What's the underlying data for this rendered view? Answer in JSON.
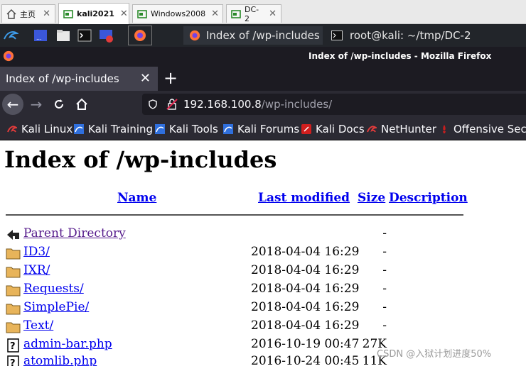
{
  "vm_tabs": [
    {
      "label": "主页"
    },
    {
      "label": "kali2021"
    },
    {
      "label": "Windows2008"
    },
    {
      "label": "DC-2"
    }
  ],
  "taskbar": {
    "windows": [
      {
        "label": "Index of /wp-includes - ..."
      },
      {
        "label": "root@kali: ~/tmp/DC-2"
      }
    ]
  },
  "firefox": {
    "window_title": "Index of /wp-includes - Mozilla Firefox",
    "tab_title": "Index of /wp-includes",
    "new_tab": "+",
    "url_host": "192.168.100.8",
    "url_path": "/wp-includes/"
  },
  "bookmarks": [
    {
      "label": "Kali Linux",
      "color": "#e23b3b"
    },
    {
      "label": "Kali Training",
      "color": "#2f6fdd"
    },
    {
      "label": "Kali Tools",
      "color": "#2f6fdd"
    },
    {
      "label": "Kali Forums",
      "color": "#2f6fdd"
    },
    {
      "label": "Kali Docs",
      "color": "#d01e1e"
    },
    {
      "label": "NetHunter",
      "color": "#e23b3b"
    },
    {
      "label": "Offensive Security",
      "color": "#c81e1e"
    }
  ],
  "listing": {
    "heading": "Index of /wp-includes",
    "columns": {
      "name": "Name",
      "last_modified": "Last modified",
      "size": "Size",
      "description": "Description"
    },
    "rows": [
      {
        "name": "Parent Directory",
        "date": "",
        "size": "-",
        "icon": "back-icon"
      },
      {
        "name": "ID3/",
        "date": "2018-04-04 16:29",
        "size": "-",
        "icon": "folder-icon"
      },
      {
        "name": "IXR/",
        "date": "2018-04-04 16:29",
        "size": "-",
        "icon": "folder-icon"
      },
      {
        "name": "Requests/",
        "date": "2018-04-04 16:29",
        "size": "-",
        "icon": "folder-icon"
      },
      {
        "name": "SimplePie/",
        "date": "2018-04-04 16:29",
        "size": "-",
        "icon": "folder-icon"
      },
      {
        "name": "Text/",
        "date": "2018-04-04 16:29",
        "size": "-",
        "icon": "folder-icon"
      },
      {
        "name": "admin-bar.php",
        "date": "2016-10-19 00:47",
        "size": "27K",
        "icon": "unknown-file-icon"
      },
      {
        "name": "atomlib.php",
        "date": "2016-10-24 00:45",
        "size": "11K",
        "icon": "unknown-file-icon"
      }
    ]
  },
  "watermark": "CSDN @入狱计划进度50%"
}
